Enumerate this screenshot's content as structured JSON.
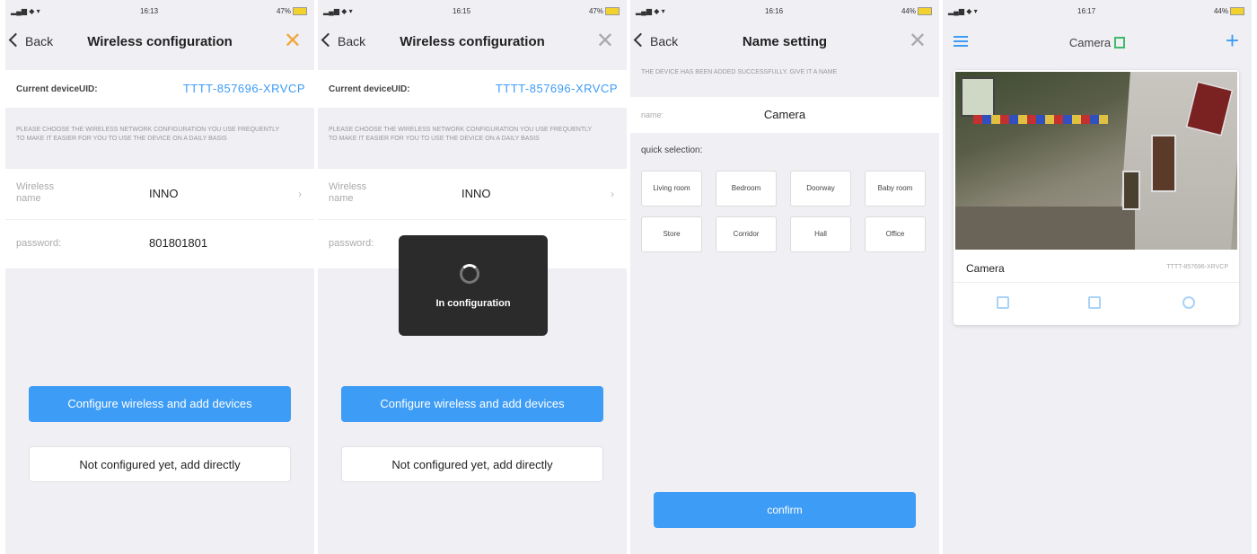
{
  "status": {
    "panel1": {
      "time": "16:13",
      "battery": "47%"
    },
    "panel2": {
      "time": "16:15",
      "battery": "47%"
    },
    "panel3": {
      "time": "16:16",
      "battery": "44%"
    },
    "panel4": {
      "time": "16:17",
      "battery": "44%"
    }
  },
  "wireless": {
    "back_label": "Back",
    "title": "Wireless configuration",
    "uid_label": "Current deviceUID:",
    "uid_value": "TTTT-857696-XRVCP",
    "hint": "PLEASE CHOOSE THE WIRELESS NETWORK CONFIGURATION YOU USE FREQUENTLY TO MAKE IT EASIER FOR YOU TO USE THE DEVICE ON A DAILY BASIS",
    "wireless_name_label": "Wireless name",
    "wireless_name_value": "INNO",
    "password_label": "password:",
    "password_value": "801801801",
    "configure_button": "Configure wireless and add devices",
    "skip_button": "Not configured yet, add directly",
    "loading_text": "In configuration"
  },
  "name_setting": {
    "back_label": "Back",
    "title": "Name setting",
    "notice": "THE DEVICE HAS BEEN ADDED SUCCESSFULLY. GIVE IT A NAME",
    "name_label": "name:",
    "name_value": "Camera",
    "quick_title": "quick selection:",
    "chips": [
      "Living room",
      "Bedroom",
      "Doorway",
      "Baby room",
      "Store",
      "Corridor",
      "Hall",
      "Office"
    ],
    "confirm_button": "confirm"
  },
  "camera_list": {
    "title": "Camera",
    "card": {
      "name": "Camera",
      "uid": "TTTT-857696-XRVCP"
    }
  },
  "colors": {
    "accent": "#3d9cf5",
    "close": "#f0a73c",
    "list_icon": "#3dbb6a"
  }
}
